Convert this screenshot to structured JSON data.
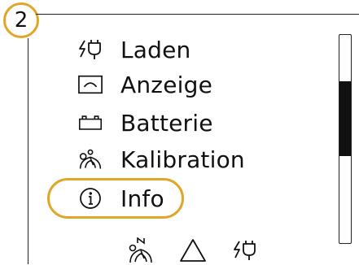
{
  "step_badge": "2",
  "menu": {
    "items": [
      {
        "id": "laden",
        "label": "Laden",
        "icon": "charging-icon"
      },
      {
        "id": "anzeige",
        "label": "Anzeige",
        "icon": "display-icon"
      },
      {
        "id": "batterie",
        "label": "Batterie",
        "icon": "battery-icon"
      },
      {
        "id": "kalibration",
        "label": "Kalibration",
        "icon": "calibration-icon"
      },
      {
        "id": "info",
        "label": "Info",
        "icon": "info-icon"
      }
    ],
    "selected": "info"
  },
  "scrollbar": {
    "position": 0.35,
    "visible_fraction": 0.36
  },
  "bottom_icons": [
    "calibration-north-icon",
    "warning-triangle-icon",
    "charging-icon"
  ],
  "colors": {
    "accent": "#e0a62a",
    "text": "#111111",
    "background": "#ffffff"
  }
}
